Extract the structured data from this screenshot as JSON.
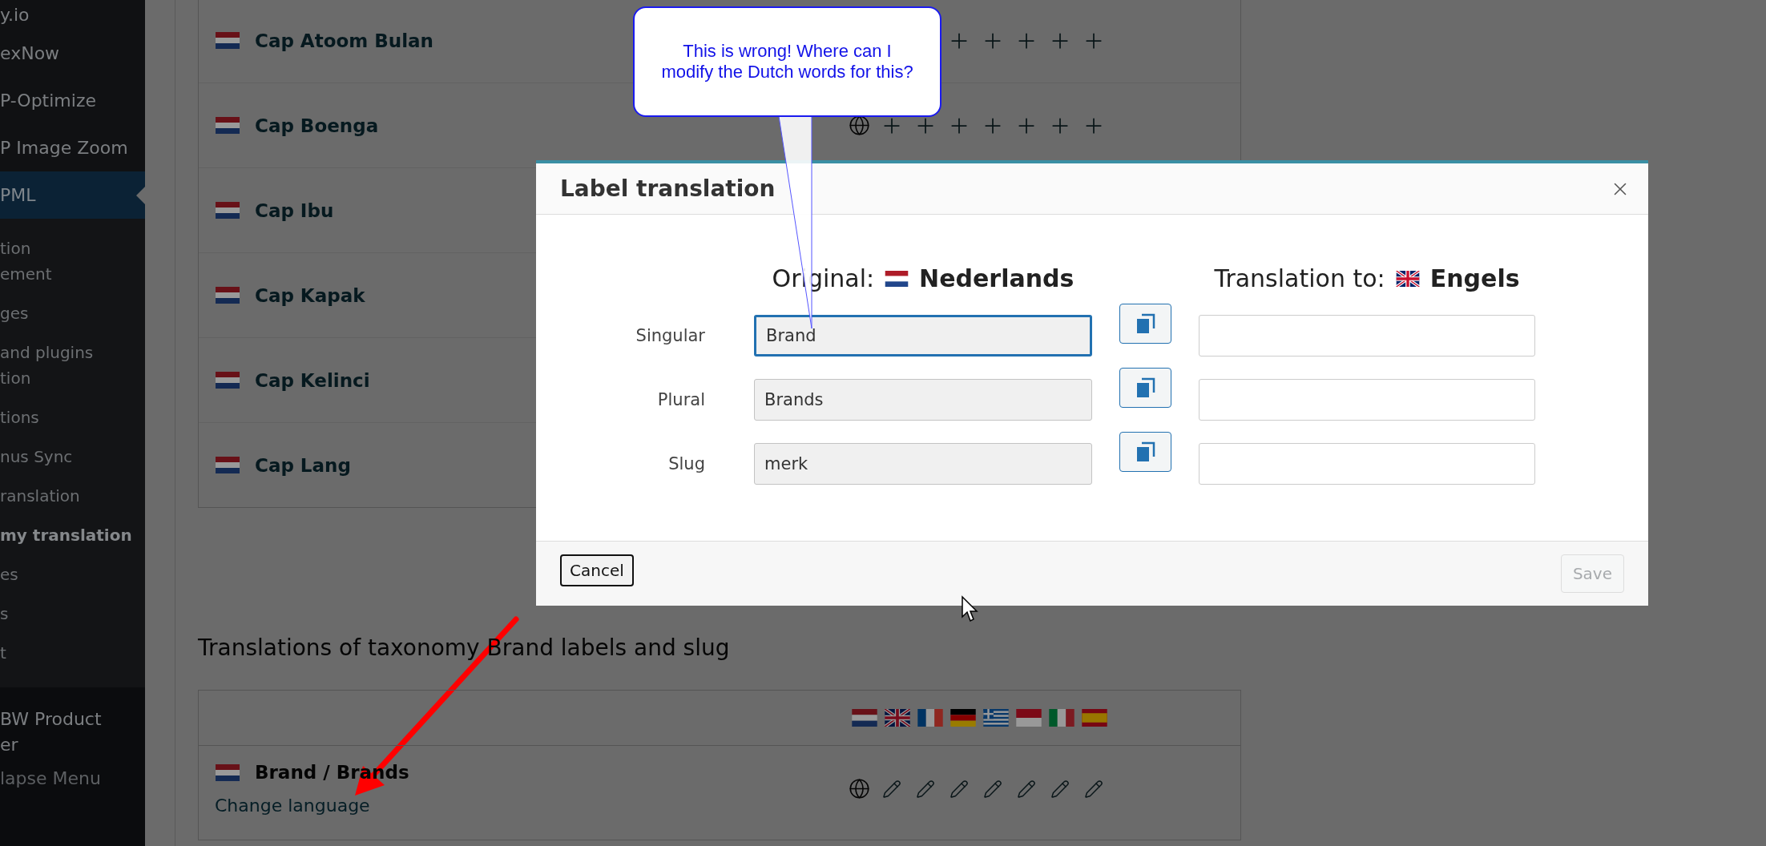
{
  "sidebar": {
    "items": [
      {
        "label": "y.io",
        "kind": "menu"
      },
      {
        "label": "exNow",
        "kind": "menu"
      },
      {
        "label": "P-Optimize",
        "kind": "menu"
      },
      {
        "label": "P Image Zoom",
        "kind": "menu"
      },
      {
        "label": "PML",
        "kind": "current",
        "children": [
          {
            "label": "tion\nement",
            "selected": false
          },
          {
            "label": "ges",
            "selected": false
          },
          {
            "label": "and plugins\ntion",
            "selected": false
          },
          {
            "label": "tions",
            "selected": false
          },
          {
            "label": "nus Sync",
            "selected": false
          },
          {
            "label": "ranslation",
            "selected": false
          },
          {
            "label": "my translation",
            "selected": true
          },
          {
            "label": "es",
            "selected": false
          },
          {
            "label": "s",
            "selected": false
          },
          {
            "label": "t",
            "selected": false
          }
        ]
      },
      {
        "label": "BW Product\ner",
        "kind": "menu"
      },
      {
        "label": "lapse Menu",
        "kind": "collapse"
      }
    ]
  },
  "term_rows": [
    {
      "name": "Cap Atoom Bulan",
      "kind": "add"
    },
    {
      "name": "Cap Boenga",
      "kind": "untranslated"
    },
    {
      "name": "Cap Ibu",
      "kind": "covered"
    },
    {
      "name": "Cap Kapak",
      "kind": "covered"
    },
    {
      "name": "Cap Kelinci",
      "kind": "covered"
    },
    {
      "name": "Cap Lang",
      "kind": "covered"
    }
  ],
  "section_title": "Translations of taxonomy Brand labels and slug",
  "label_table": {
    "rows": [
      {
        "name": "Brand / Brands",
        "link": "Change language",
        "kind": "translated"
      }
    ]
  },
  "dialog": {
    "title": "Label translation",
    "original_label": "Original:",
    "original_language": "Nederlands",
    "target_label": "Translation to:",
    "target_language": "Engels",
    "fields": [
      {
        "label": "Singular",
        "original": "Brand",
        "focused": true
      },
      {
        "label": "Plural",
        "original": "Brands",
        "focused": false
      },
      {
        "label": "Slug",
        "original": "merk",
        "focused": false
      }
    ],
    "cancel": "Cancel",
    "save": {
      "label": "Save",
      "disabled": true
    }
  },
  "callout": {
    "text": "This is wrong! Where can I\nmodify the Dutch words for this?"
  }
}
